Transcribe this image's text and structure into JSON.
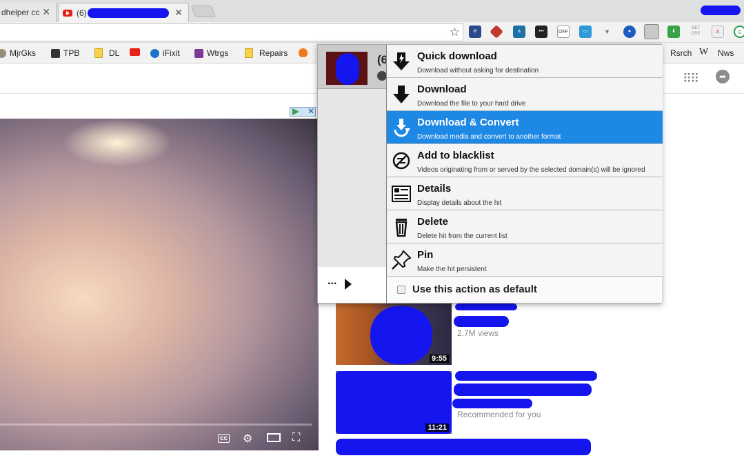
{
  "browser": {
    "tabs": [
      {
        "title": "dhelper cc",
        "active": false
      },
      {
        "title": "(6)",
        "active": true
      }
    ],
    "omnibox_value": ""
  },
  "bookmarks": [
    {
      "label": "MjrGks",
      "icon": "gears-icon"
    },
    {
      "label": "TPB",
      "icon": "ship-icon"
    },
    {
      "label": "DL",
      "icon": "folder-icon"
    },
    {
      "label": "",
      "icon": "youtube-icon"
    },
    {
      "label": "iFixit",
      "icon": "ifixit-icon"
    },
    {
      "label": "Wtrgs",
      "icon": "wtrgs-icon"
    },
    {
      "label": "Repairs",
      "icon": "folder-icon"
    },
    {
      "label": "",
      "icon": "fire-icon"
    },
    {
      "label": "Rsrch",
      "icon": "folder-icon"
    },
    {
      "label": "",
      "icon": "wikipedia-icon"
    },
    {
      "label": "Nws",
      "icon": "folder-icon"
    }
  ],
  "popup": {
    "hit_title_partial": "(6",
    "more_label": "...",
    "menu": [
      {
        "title": "Quick download",
        "desc": "Download without asking for destination",
        "icon": "quick-download-icon"
      },
      {
        "title": "Download",
        "desc": "Download the file to your hard drive",
        "icon": "download-icon"
      },
      {
        "title": "Download & Convert",
        "desc": "Download media and convert to another format",
        "icon": "download-convert-icon"
      },
      {
        "title": "Add to blacklist",
        "desc": "Videos originating from or served by the selected domain(s) will be ignored",
        "icon": "blacklist-icon"
      },
      {
        "title": "Details",
        "desc": "Display details about the hit",
        "icon": "details-icon"
      },
      {
        "title": "Delete",
        "desc": "Delete hit from the current list",
        "icon": "trash-icon"
      },
      {
        "title": "Pin",
        "desc": "Make the hit persistent",
        "icon": "pin-icon"
      }
    ],
    "selected_index": 2,
    "default_action_label": "Use this action as default",
    "default_action_checked": false
  },
  "sidebar": {
    "videos": [
      {
        "duration": "9:55",
        "views": "2.7M views"
      },
      {
        "duration": "11:21",
        "meta": "Recommended for you"
      }
    ]
  },
  "colors": {
    "selected": "#1e88e5",
    "youtube_red": "#e62117"
  }
}
